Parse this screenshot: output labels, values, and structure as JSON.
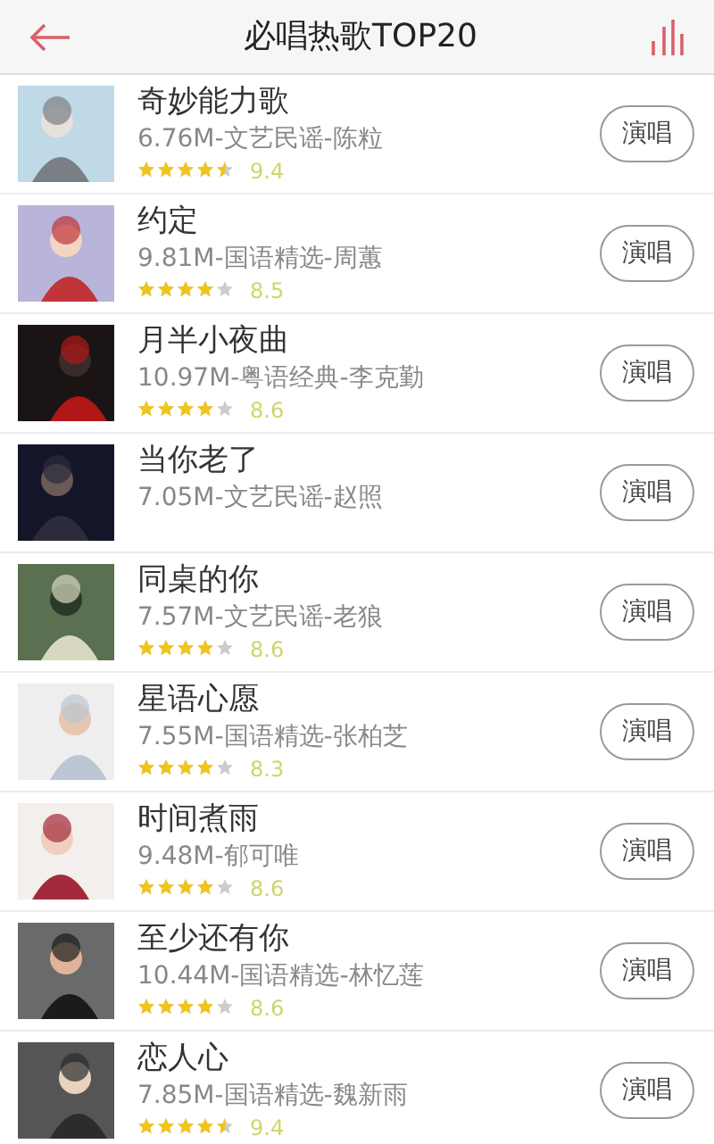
{
  "header": {
    "title": "必唱热歌TOP20"
  },
  "songs": [
    {
      "title": "奇妙能力歌",
      "meta": "6.76M-文艺民谣-陈粒",
      "stars": 4.5,
      "score": "9.4",
      "button": "演唱"
    },
    {
      "title": "约定",
      "meta": "9.81M-国语精选-周蕙",
      "stars": 4,
      "score": "8.5",
      "button": "演唱"
    },
    {
      "title": "月半小夜曲",
      "meta": "10.97M-粤语经典-李克勤",
      "stars": 4,
      "score": "8.6",
      "button": "演唱"
    },
    {
      "title": "当你老了",
      "meta": "7.05M-文艺民谣-赵照",
      "button": "演唱"
    },
    {
      "title": "同桌的你",
      "meta": "7.57M-文艺民谣-老狼",
      "stars": 4,
      "score": "8.6",
      "button": "演唱"
    },
    {
      "title": "星语心愿",
      "meta": "7.55M-国语精选-张柏芝",
      "stars": 4,
      "score": "8.3",
      "button": "演唱"
    },
    {
      "title": "时间煮雨",
      "meta": "9.48M-郁可唯",
      "stars": 4,
      "score": "8.6",
      "button": "演唱"
    },
    {
      "title": "至少还有你",
      "meta": "10.44M-国语精选-林忆莲",
      "stars": 4,
      "score": "8.6",
      "button": "演唱"
    },
    {
      "title": "恋人心",
      "meta": "7.85M-国语精选-魏新雨",
      "stars": 4.5,
      "score": "9.4",
      "button": "演唱"
    }
  ]
}
